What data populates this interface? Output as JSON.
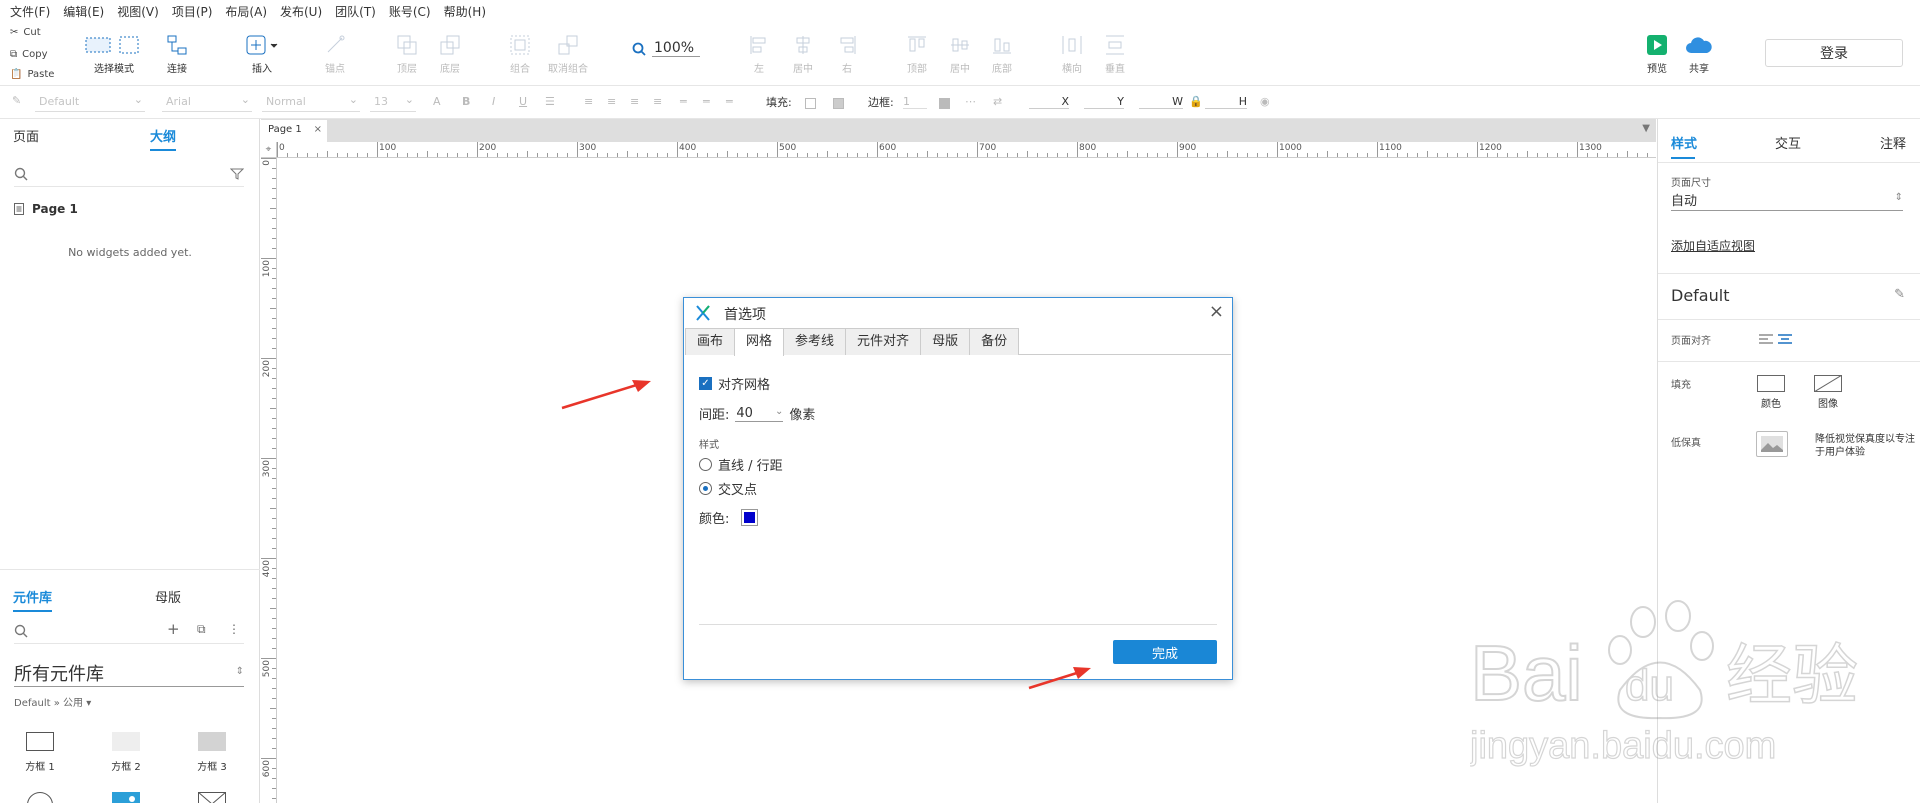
{
  "menubar": {
    "items": [
      "文件(F)",
      "编辑(E)",
      "视图(V)",
      "项目(P)",
      "布局(A)",
      "发布(U)",
      "团队(T)",
      "账号(C)",
      "帮助(H)"
    ]
  },
  "clipboard": {
    "cut": "Cut",
    "copy": "Copy",
    "paste": "Paste"
  },
  "toolbar": {
    "select_mode": "选择模式",
    "connect": "连接",
    "insert": "插入",
    "points": "锚点",
    "top": "顶层",
    "bottom": "底层",
    "group": "组合",
    "ungroup": "取消组合",
    "left": "左",
    "center": "居中",
    "right": "右",
    "align_top": "顶部",
    "align_middle": "居中",
    "align_bottom": "底部",
    "horizontal": "横向",
    "vertical": "垂直",
    "zoom": "100%",
    "preview": "预览",
    "share": "共享",
    "login": "登录"
  },
  "formatbar": {
    "style": "Default",
    "font": "Arial",
    "weight": "Normal",
    "size": "13",
    "fill_label": "填充:",
    "border_label": "边框:",
    "border_value": "1",
    "x": "X",
    "y": "Y",
    "w": "W",
    "h": "H"
  },
  "left_panel": {
    "tabs": [
      "页面",
      "大纲"
    ],
    "active_tab": "大纲",
    "page_name": "Page 1",
    "empty_text": "No widgets added yet.",
    "lib_tabs": [
      "元件库",
      "母版"
    ],
    "lib_selector": "所有元件库",
    "lib_sub": "Default » 公用 ▾",
    "widgets": [
      "方框 1",
      "方框 2",
      "方框 3"
    ]
  },
  "canvas": {
    "doc_tab": "Page 1",
    "hruler": [
      "0",
      "100",
      "200",
      "300",
      "400",
      "500",
      "600",
      "700",
      "800",
      "900",
      "1000",
      "1100",
      "1200",
      "1300"
    ],
    "vruler": [
      "0",
      "100",
      "200",
      "300",
      "400",
      "500",
      "600"
    ]
  },
  "right_panel": {
    "tabs": [
      "样式",
      "交互",
      "注释"
    ],
    "page_size_label": "页面尺寸",
    "page_size_value": "自动",
    "adaptive_link": "添加自适应视图",
    "style_name": "Default",
    "page_align_label": "页面对齐",
    "fill_label": "填充",
    "fill_color": "颜色",
    "fill_image": "图像",
    "lowfi_label": "低保真",
    "lowfi_desc": "降低视觉保真度以专注于用户体验"
  },
  "dialog": {
    "title": "首选项",
    "tabs": [
      "画布",
      "网格",
      "参考线",
      "元件对齐",
      "母版",
      "备份"
    ],
    "active_tab": "网格",
    "snap_grid": "对齐网格",
    "spacing_label": "间距:",
    "spacing_value": "40",
    "spacing_unit": "像素",
    "style_label": "样式",
    "opt_lines": "直线 / 行距",
    "opt_intersect": "交叉点",
    "color_label": "颜色:",
    "grid_color": "#0000cc",
    "done": "完成"
  },
  "watermark": {
    "brand": "Baidu经验",
    "url": "jingyan.baidu.com"
  },
  "colors": {
    "accent": "#1a87d6",
    "arrow": "#e8352a"
  }
}
